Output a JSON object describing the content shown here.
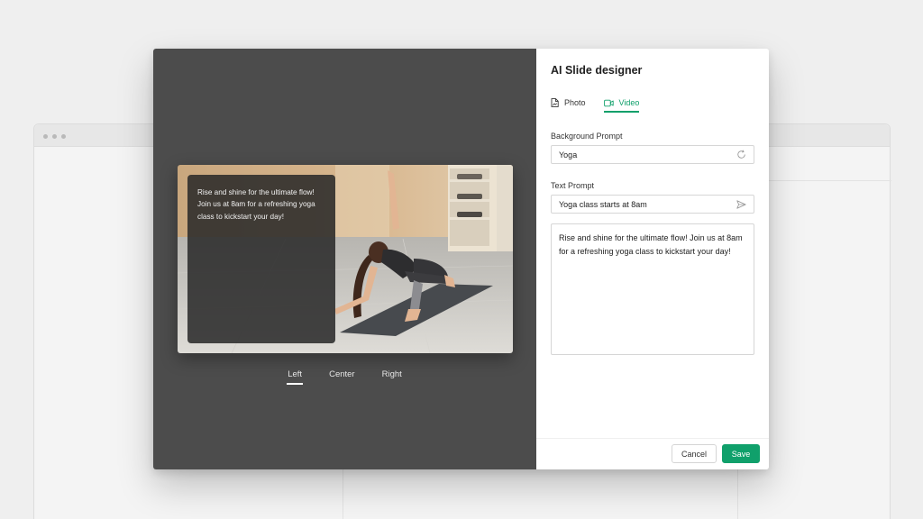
{
  "dialog": {
    "title": "AI Slide designer"
  },
  "mode_tabs": [
    {
      "label": "Photo",
      "icon": "file-image-icon",
      "active": false
    },
    {
      "label": "Video",
      "icon": "video-camera-icon",
      "active": true
    }
  ],
  "fields": {
    "background_prompt": {
      "label": "Background Prompt",
      "value": "Yoga",
      "icon": "refresh-icon"
    },
    "text_prompt": {
      "label": "Text Prompt",
      "value": "Yoga class starts at 8am",
      "icon": "send-icon"
    }
  },
  "generated_text": "Rise and shine for the ultimate flow! Join us at 8am for a refreshing yoga class to kickstart your day!",
  "slide": {
    "overlay_text": "Rise and shine for the ultimate flow! Join us at 8am for a refreshing yoga class to kickstart your day!"
  },
  "alignment_tabs": [
    {
      "label": "Left",
      "active": true
    },
    {
      "label": "Center",
      "active": false
    },
    {
      "label": "Right",
      "active": false
    }
  ],
  "footer": {
    "cancel_label": "Cancel",
    "save_label": "Save"
  },
  "colors": {
    "accent": "#10a06b",
    "preview_bg": "#4c4c4c"
  }
}
